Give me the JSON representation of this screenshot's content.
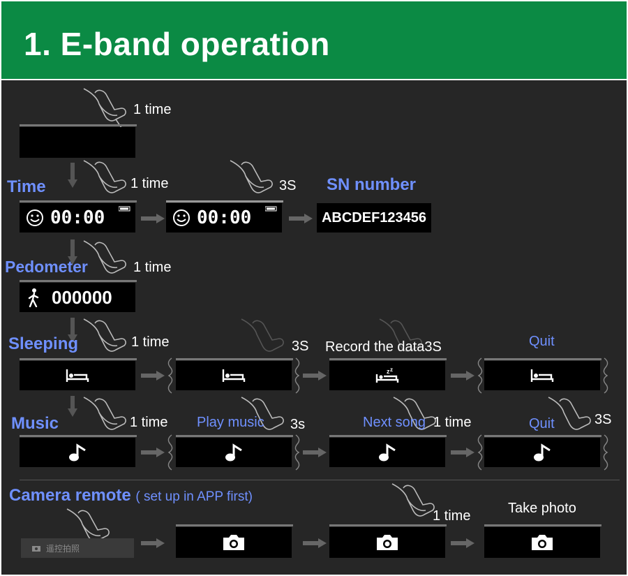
{
  "header": {
    "title": "1. E-band operation"
  },
  "sections": {
    "start": {
      "press": "1 time"
    },
    "time": {
      "label": "Time",
      "press1": "1 time",
      "press2": "3S",
      "sn_label": "SN number",
      "screen_time_1": "00:00",
      "screen_time_2": "00:00",
      "sn_value": "ABCDEF123456"
    },
    "pedometer": {
      "label": "Pedometer",
      "press": "1 time",
      "steps": "000000"
    },
    "sleeping": {
      "label": "Sleeping",
      "press1": "1 time",
      "press2": "3S",
      "record": "Record the data3S",
      "quit": "Quit"
    },
    "music": {
      "label": "Music",
      "press1": "1 time",
      "play": "Play music",
      "press2": "3s",
      "next": "Next song",
      "press3": "1 time",
      "quit": "Quit",
      "press4": "3S"
    },
    "camera": {
      "label": "Camera remote",
      "sublabel": "( set up in APP first)",
      "ghost_text": "遥控拍照",
      "press": "1 time",
      "take": "Take photo"
    }
  },
  "icons": {
    "hand": "finger-press-icon",
    "smiley": "smiley-icon",
    "battery": "battery-icon",
    "walker": "walking-person-icon",
    "bed": "bed-icon",
    "sleep_bed": "sleeping-bed-zz-icon",
    "music": "music-note-icon",
    "camera": "camera-icon",
    "arrow": "right-arrow-icon",
    "down_arrow": "down-arrow-icon"
  },
  "colors": {
    "header_bg": "#0b8a44",
    "panel_bg": "#262626",
    "label_blue": "#6f90ff",
    "screen_bg": "#000000"
  }
}
